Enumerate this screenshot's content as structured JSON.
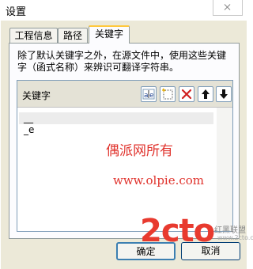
{
  "window": {
    "title": "设置"
  },
  "tabs": [
    {
      "label": "工程信息"
    },
    {
      "label": "路径"
    },
    {
      "label": "关键字"
    }
  ],
  "active_tab": "关键字",
  "panel": {
    "description": "除了默认关键字之外，在源文件中，使用这些关键字（函式名称）来辨识可翻译字符串。",
    "list_header": "关键字",
    "toolbar": {
      "new_icon": "ab-text-icon",
      "add_icon": "new-item-icon",
      "delete_icon": "delete-x-icon",
      "move_up_icon": "arrow-up-icon",
      "move_down_icon": "arrow-down-icon"
    },
    "keywords": [
      "__",
      "_e"
    ]
  },
  "buttons": {
    "ok_label": "确定",
    "cancel_label": "取消"
  },
  "watermarks": {
    "site_cn": "偶派网所有",
    "site_url": "www.olpie.com",
    "logo": "2cto",
    "logo_sub": "红黑联盟",
    "logo_sub_small": "www.2cto.com"
  },
  "colors": {
    "watermark_red": "#e0322c",
    "active_tab_accent": "#ffc83c",
    "logo_red": "#e83a2f"
  }
}
